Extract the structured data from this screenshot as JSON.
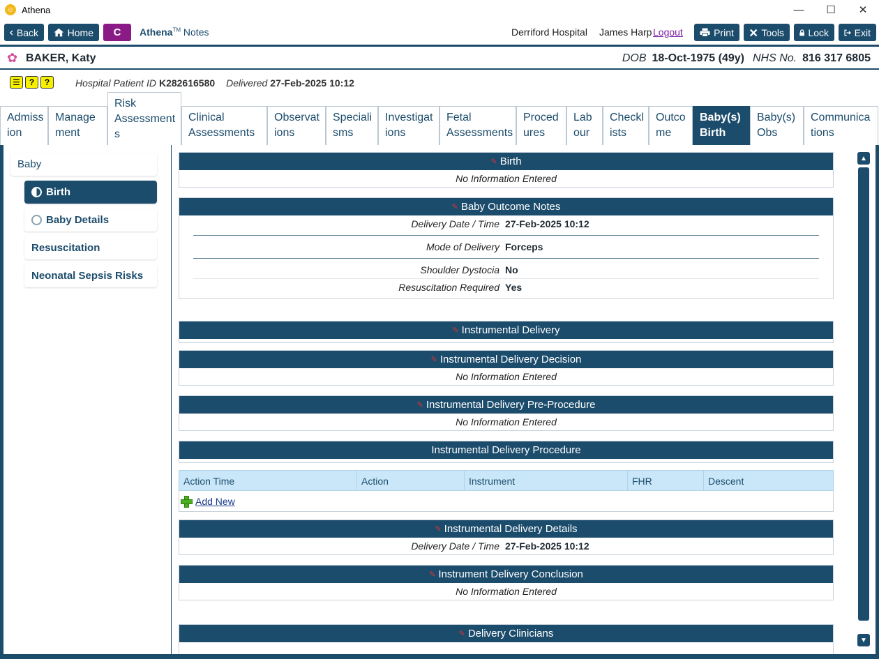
{
  "window": {
    "title": "Athena",
    "app_icon": "athena-logo-icon",
    "controls": {
      "minimize": "—",
      "maximize": "☐",
      "close": "✕"
    }
  },
  "toolbar": {
    "back": "Back",
    "home": "Home",
    "c": "C",
    "product_brand": "Athena",
    "product_tm": "TM",
    "product_module": " Notes",
    "hospital": "Derriford Hospital",
    "user": "James Harp",
    "logout": "Logout",
    "print": "Print",
    "tools": "Tools",
    "lock": "Lock",
    "exit": "Exit"
  },
  "patient": {
    "name": "BAKER, Katy",
    "dob_label": "DOB",
    "dob": "18-Oct-1975 (49y)",
    "nhs_label": "NHS No.",
    "nhs": "816 317 6805",
    "hospital_id_label": "Hospital Patient ID",
    "hospital_id": "K282616580",
    "delivered_label": "Delivered",
    "delivered": "27-Feb-2025 10:12",
    "alert_icons": [
      "☰",
      "?",
      "?"
    ]
  },
  "tabs": [
    {
      "label": "Admiss ion"
    },
    {
      "label": "Manage ment"
    },
    {
      "label": "Risk Assessment s"
    },
    {
      "label": "Clinical Assessments"
    },
    {
      "label": "Observat ions"
    },
    {
      "label": "Speciali sms"
    },
    {
      "label": "Investigat ions"
    },
    {
      "label": "Fetal Assessments"
    },
    {
      "label": "Proced ures"
    },
    {
      "label": "Lab our"
    },
    {
      "label": "Checkl ists"
    },
    {
      "label": "Outco me"
    },
    {
      "label": "Baby(s) Birth"
    },
    {
      "label": "Baby(s) Obs"
    },
    {
      "label": "Communica tions"
    }
  ],
  "sidebar": {
    "items": [
      {
        "label": "Baby"
      },
      {
        "label": "Birth"
      },
      {
        "label": "Baby Details"
      },
      {
        "label": "Resuscitation"
      },
      {
        "label": "Neonatal Sepsis Risks"
      }
    ]
  },
  "sections": {
    "birth": {
      "title": "Birth",
      "no_info": "No Information Entered"
    },
    "outcome": {
      "title": "Baby Outcome Notes",
      "fields": [
        {
          "label": "Delivery Date / Time",
          "value": "27-Feb-2025 10:12"
        },
        {
          "label": "Mode of Delivery",
          "value": "Forceps"
        },
        {
          "label": "Shoulder Dystocia",
          "value": "No"
        },
        {
          "label": "Resuscitation Required",
          "value": "Yes"
        }
      ]
    },
    "instrumental": {
      "title": "Instrumental Delivery"
    },
    "decision": {
      "title": "Instrumental Delivery Decision",
      "no_info": "No Information Entered"
    },
    "pre_procedure": {
      "title": "Instrumental Delivery Pre-Procedure",
      "no_info": "No Information Entered"
    },
    "procedure": {
      "title": "Instrumental Delivery Procedure",
      "columns": [
        "Action Time",
        "Action",
        "Instrument",
        "FHR",
        "Descent"
      ],
      "add_new": "Add New"
    },
    "details": {
      "title": "Instrumental Delivery Details",
      "fields": [
        {
          "label": "Delivery Date / Time",
          "value": "27-Feb-2025 10:12"
        }
      ]
    },
    "conclusion": {
      "title": "Instrument Delivery Conclusion",
      "no_info": "No Information Entered"
    },
    "clinicians": {
      "title": "Delivery Clinicians"
    }
  },
  "colors": {
    "primary": "#1c4c6c",
    "c_button": "#8a1a86",
    "table_header": "#c9e7f8",
    "alert_yellow": "#f6f000",
    "add_green": "#4caf1e"
  }
}
